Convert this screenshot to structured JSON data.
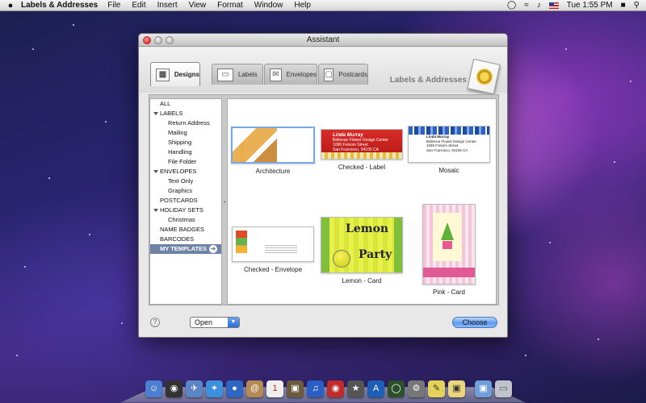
{
  "menubar": {
    "apple": "",
    "app_name": "Labels & Addresses",
    "items": [
      "File",
      "Edit",
      "Insert",
      "View",
      "Format",
      "Window",
      "Help"
    ],
    "clock": "Tue 1:55 PM"
  },
  "window": {
    "title": "Assistant",
    "brand": "Labels & Addresses",
    "tabs": [
      {
        "label": "Designs",
        "icon": "designs-icon"
      },
      {
        "label": "Labels",
        "icon": "labels-icon"
      },
      {
        "label": "Envelopes",
        "icon": "envelopes-icon"
      },
      {
        "label": "Postcards",
        "icon": "postcards-icon"
      }
    ],
    "active_tab": "Designs"
  },
  "sidebar": {
    "items": [
      {
        "label": "ALL",
        "level": 0
      },
      {
        "label": "LABELS",
        "level": 0,
        "expanded": true
      },
      {
        "label": "Return Address",
        "level": 1
      },
      {
        "label": "Mailing",
        "level": 1
      },
      {
        "label": "Shipping",
        "level": 1
      },
      {
        "label": "Handling",
        "level": 1
      },
      {
        "label": "File Folder",
        "level": 1
      },
      {
        "label": "ENVELOPES",
        "level": 0,
        "expanded": true
      },
      {
        "label": "Text Only",
        "level": 1
      },
      {
        "label": "Graphics",
        "level": 1
      },
      {
        "label": "POSTCARDS",
        "level": 0
      },
      {
        "label": "HOLIDAY SETS",
        "level": 0,
        "expanded": true
      },
      {
        "label": "Christmas",
        "level": 1
      },
      {
        "label": "NAME BADGES",
        "level": 0
      },
      {
        "label": "BARCODES",
        "level": 0
      },
      {
        "label": "MY TEMPLATES",
        "level": 0,
        "selected": true
      }
    ]
  },
  "templates": [
    {
      "label": "Architecture",
      "selected": true
    },
    {
      "label": "Checked - Label",
      "thumb_text": {
        "name": "Linda Murray",
        "line1": "Bellevue Flower Design Center",
        "line2": "1096 Folsom Street",
        "line3": "San Francisco, 94105 CA"
      }
    },
    {
      "label": "Mosaic",
      "thumb_text": {
        "name": "Linda Murray",
        "line1": "Bellevue Flower Design Center",
        "line2": "1096 Folsom Street",
        "line3": "San Francisco, 94105 CA"
      }
    },
    {
      "label": "Checked - Envelope"
    },
    {
      "label": "Lemon - Card",
      "thumb_text": {
        "line1": "Lemon",
        "line2": "Party"
      }
    },
    {
      "label": "Pink - Card"
    }
  ],
  "footer": {
    "help": "?",
    "open_select": "Open",
    "choose_button": "Choose"
  },
  "colors": {
    "selection": "#6f83a6",
    "choose_button": "#5f9bf0"
  }
}
